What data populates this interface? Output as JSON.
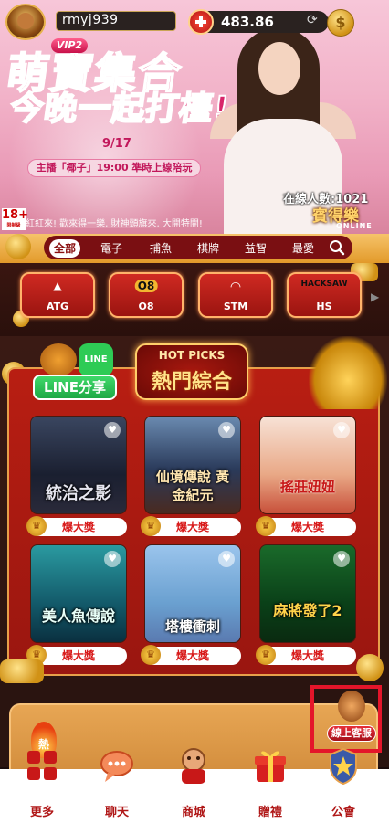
{
  "header": {
    "username": "rmyj939",
    "vip_badge": "VIP2",
    "balance": "483.86",
    "coin_symbol": "$",
    "refresh_glyph": "⟳"
  },
  "banner": {
    "title_line1": "萌寶集合",
    "title_line2": "今晚一起打檯!",
    "date": "9/17",
    "host_text": "主播「椰子」19:00 準時上線陪玩",
    "online_label": "在線人數:1021",
    "brand": "賓得樂",
    "brand_sub": "ONLINE",
    "age_label": "18+",
    "age_sub": "限制級",
    "marquee": "紅紅來! 歡來得一樂, 財神頭旗來, 大開特開!"
  },
  "categories": {
    "items": [
      "全部",
      "電子",
      "捕魚",
      "棋牌",
      "益智",
      "最愛"
    ],
    "active": "全部"
  },
  "providers": [
    {
      "name": "ATG",
      "icon": "ATG"
    },
    {
      "name": "O8",
      "icon": "O8"
    },
    {
      "name": "STM",
      "icon": "◠"
    },
    {
      "name": "HS",
      "icon": "HACKSAW"
    }
  ],
  "hot_picks": {
    "sign_en": "HOT PICKS",
    "sign_cn": "熱門綜合",
    "line_icon": "LINE",
    "line_share": "LINE分享",
    "games": [
      {
        "title": "統治之影",
        "badge": "爆大獎"
      },
      {
        "title": "仙境傳說 黃金紀元",
        "badge": "爆大獎"
      },
      {
        "title": "搖莊妞妞",
        "badge": "爆大獎"
      },
      {
        "title": "美人魚傳說",
        "badge": "爆大獎"
      },
      {
        "title": "塔樓衝刺",
        "badge": "爆大獎"
      },
      {
        "title": "麻將發了2",
        "badge": "爆大獎"
      }
    ]
  },
  "hot_badge": "熱",
  "customer_service": "線上客服",
  "nav": [
    {
      "label": "更多",
      "icon": "grid-icon"
    },
    {
      "label": "聊天",
      "icon": "chat-icon"
    },
    {
      "label": "商城",
      "icon": "shop-icon"
    },
    {
      "label": "贈禮",
      "icon": "gift-icon"
    },
    {
      "label": "公會",
      "icon": "guild-icon"
    }
  ],
  "colors": {
    "accent_red": "#b01818",
    "gold": "#e7a04a",
    "line_green": "#2ecb55",
    "cs_highlight": "#e4152a"
  }
}
